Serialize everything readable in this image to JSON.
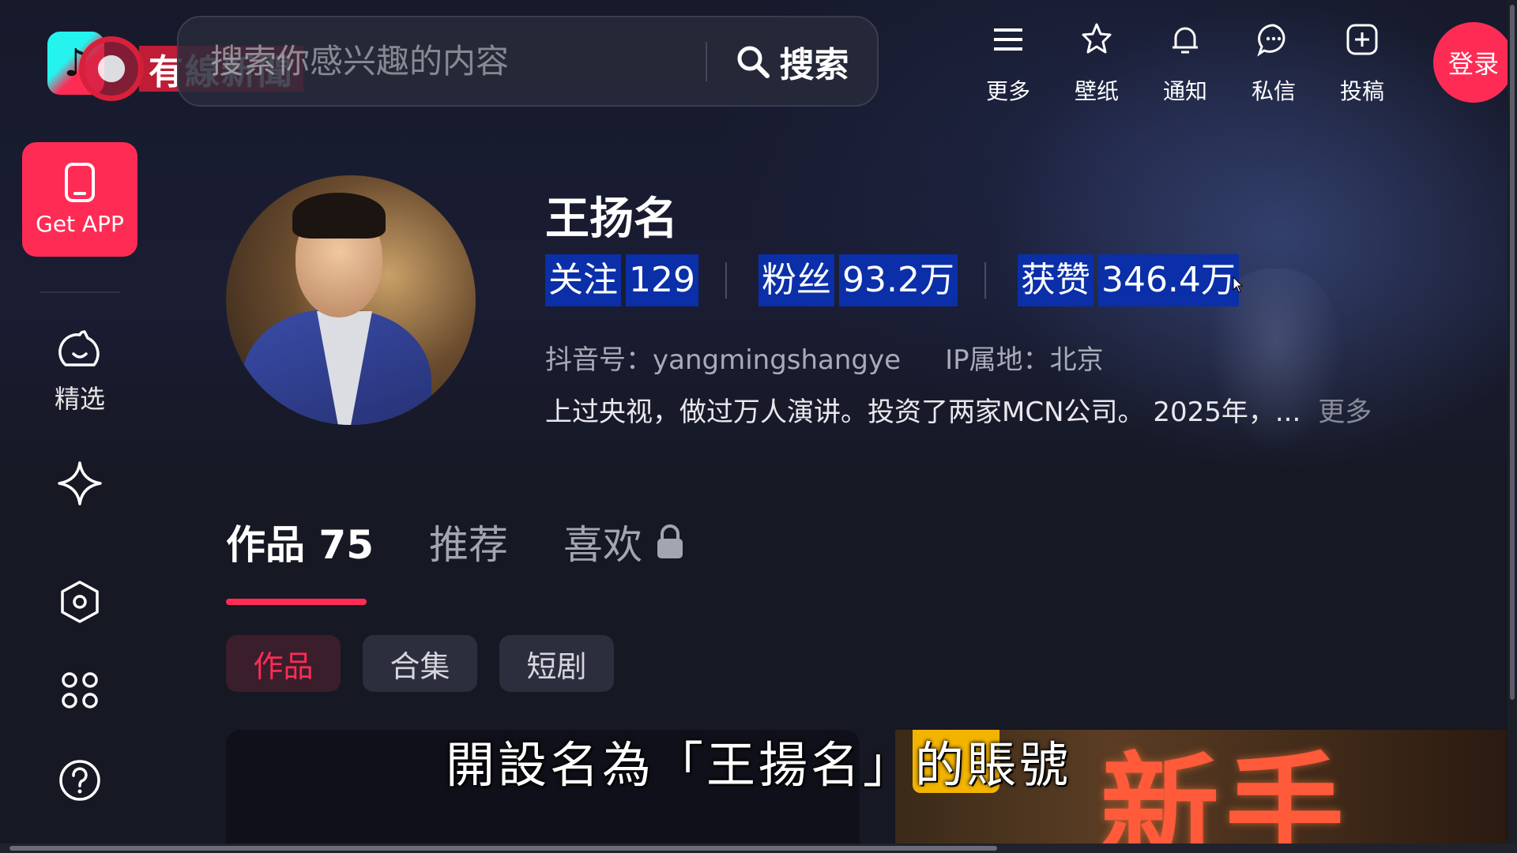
{
  "search": {
    "placeholder": "搜索你感兴趣的内容",
    "button_label": "搜索"
  },
  "watermark": {
    "text": "有線新聞"
  },
  "top_actions": [
    {
      "label": "更多",
      "icon": "menu-icon"
    },
    {
      "label": "壁纸",
      "icon": "wallpaper-icon"
    },
    {
      "label": "通知",
      "icon": "bell-icon"
    },
    {
      "label": "私信",
      "icon": "message-icon"
    },
    {
      "label": "投稿",
      "icon": "upload-icon"
    }
  ],
  "login_label": "登录",
  "sidebar": {
    "get_app_label": "Get APP",
    "items": [
      {
        "label": "精选",
        "icon": "featured-icon"
      },
      {
        "label": "",
        "icon": "sparkle-icon"
      },
      {
        "label": "",
        "icon": "settings-icon"
      },
      {
        "label": "",
        "icon": "apps-icon"
      },
      {
        "label": "",
        "icon": "help-icon"
      }
    ]
  },
  "profile": {
    "name": "王扬名",
    "stats": [
      {
        "label": "关注",
        "value": "129"
      },
      {
        "label": "粉丝",
        "value": "93.2万"
      },
      {
        "label": "获赞",
        "value": "346.4万"
      }
    ],
    "douyin_id": "抖音号：yangmingshangye",
    "ip_location": "IP属地：北京",
    "bio": "上过央视，做过万人演讲。投资了两家MCN公司。 2025年，...",
    "bio_more": "更多"
  },
  "tabs": [
    {
      "label": "作品 75",
      "active": true
    },
    {
      "label": "推荐",
      "active": false
    },
    {
      "label": "喜欢",
      "active": false,
      "locked": true
    }
  ],
  "chips": [
    {
      "label": "作品",
      "active": true
    },
    {
      "label": "合集",
      "active": false
    },
    {
      "label": "短剧",
      "active": false
    }
  ],
  "video_overlay_text": "新手",
  "subtitle": "開設名為「王揚名」的賬號",
  "colors": {
    "accent": "#fe2c55",
    "background": "#161823",
    "highlight": "#0a2fa8"
  }
}
